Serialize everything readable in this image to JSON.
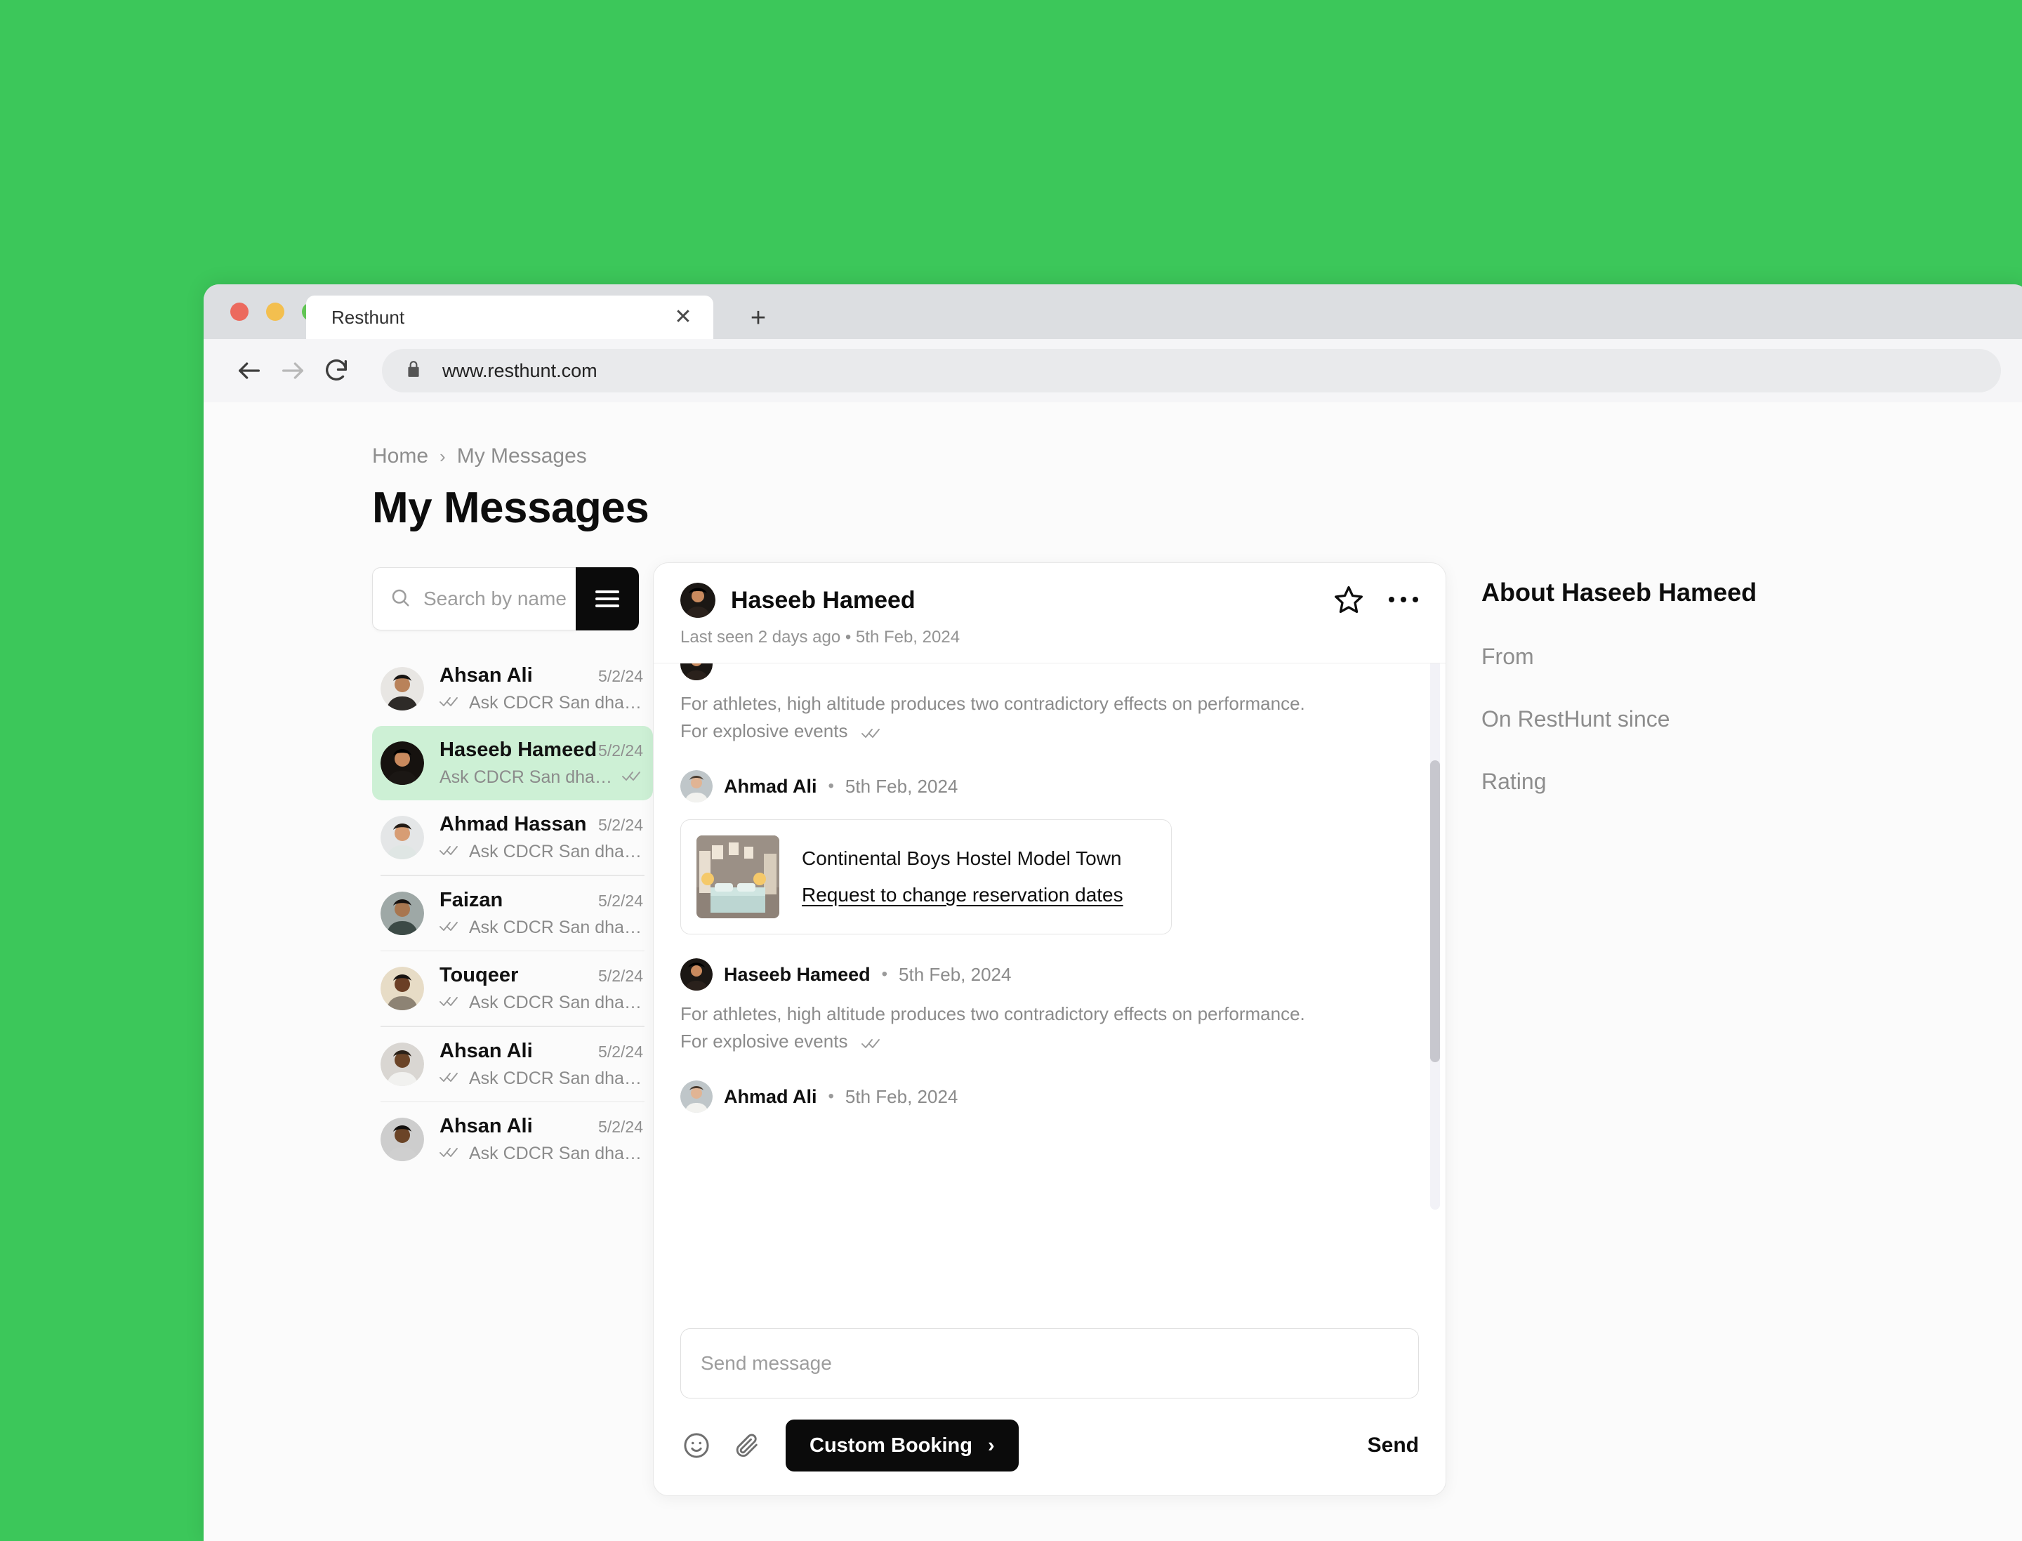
{
  "desktop": {
    "background_color": "#3cc75a"
  },
  "browser": {
    "tab_title": "Resthunt",
    "tab_close_icon": "close-icon",
    "new_tab_icon": "plus-icon",
    "back_icon": "arrow-left-icon",
    "forward_icon": "arrow-right-icon",
    "reload_icon": "reload-icon",
    "lock_icon": "lock-icon",
    "url": "www.resthunt.com"
  },
  "breadcrumb": {
    "home": "Home",
    "separator": "›",
    "current": "My Messages"
  },
  "page": {
    "title": "My Messages"
  },
  "search": {
    "placeholder": "Search by name",
    "value": "",
    "icon": "search-icon",
    "filter_icon": "hamburger-icon"
  },
  "conversations": [
    {
      "name": "Ahsan Ali",
      "date": "5/2/24",
      "preview": "Ask CDCR San dha whta dha...",
      "ticks": "✓✓",
      "ticks_leading": true,
      "selected": false
    },
    {
      "name": "Haseeb Hameed",
      "date": "5/2/24",
      "preview": "Ask CDCR San dha whta...",
      "ticks": "✓✓",
      "ticks_leading": false,
      "selected": true
    },
    {
      "name": "Ahmad Hassan",
      "date": "5/2/24",
      "preview": "Ask CDCR San dha whta dha...",
      "ticks": "✓✓",
      "ticks_leading": true,
      "selected": false
    },
    {
      "name": "Faizan",
      "date": "5/2/24",
      "preview": "Ask CDCR San dha whta dha...",
      "ticks": "✓✓",
      "ticks_leading": true,
      "selected": false
    },
    {
      "name": "Touqeer",
      "date": "5/2/24",
      "preview": "Ask CDCR San dha whta dha...",
      "ticks": "✓✓",
      "ticks_leading": true,
      "selected": false
    },
    {
      "name": "Ahsan Ali",
      "date": "5/2/24",
      "preview": "Ask CDCR San dha whta dha...",
      "ticks": "✓✓",
      "ticks_leading": true,
      "selected": false
    },
    {
      "name": "Ahsan Ali",
      "date": "5/2/24",
      "preview": "Ask CDCR San dha whta dha...",
      "ticks": "✓✓",
      "ticks_leading": true,
      "selected": false
    }
  ],
  "chat": {
    "header": {
      "name": "Haseeb Hameed",
      "last_seen": "Last seen 2 days ago",
      "separator": "•",
      "date": "5th Feb, 2024",
      "star_icon": "star-icon",
      "more_icon": "more-horizontal-icon"
    },
    "messages": [
      {
        "kind": "text-only",
        "text": "For athletes, high altitude produces two contradictory effects on performance. For explosive events",
        "ticks": "✓✓"
      },
      {
        "kind": "header",
        "author": "Ahmad Ali",
        "dot": "•",
        "date": "5th Feb, 2024"
      },
      {
        "kind": "booking-card",
        "title": "Continental Boys Hostel Model Town",
        "link": "Request to change reservation dates"
      },
      {
        "kind": "header",
        "author": "Haseeb Hameed",
        "dot": "•",
        "date": "5th Feb, 2024"
      },
      {
        "kind": "text-only",
        "text": "For athletes, high altitude produces two contradictory effects on performance. For explosive events",
        "ticks": "✓✓"
      },
      {
        "kind": "header",
        "author": "Ahmad Ali",
        "dot": "•",
        "date": "5th Feb, 2024"
      }
    ],
    "composer": {
      "placeholder": "Send message",
      "value": "",
      "emoji_icon": "smiley-icon",
      "attach_icon": "paperclip-icon",
      "custom_booking_label": "Custom Booking",
      "custom_booking_chevron": "›",
      "send_label": "Send"
    }
  },
  "about_panel": {
    "title": "About Haseeb Hameed",
    "rows": [
      "From",
      "On RestHunt since",
      "Rating"
    ]
  },
  "colors": {
    "accent_green": "#3cc75a",
    "selected_row": "#cdf0d5",
    "dark_button": "#0b0b0b"
  }
}
